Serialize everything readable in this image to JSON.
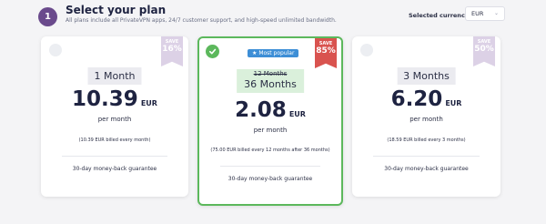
{
  "header": {
    "step_number": "1",
    "title": "Select your plan",
    "subtitle": "All plans include all PrivateVPN apps, 24/7 customer support, and high-speed unlimited bandwidth.",
    "currency_label": "Selected currency:",
    "currency_value": "EUR"
  },
  "plans": [
    {
      "duration": "1 Month",
      "price": "10.39",
      "currency": "EUR",
      "per": "per month",
      "billed": "(10.39 EUR billed every month)",
      "guarantee": "30-day money-back guarantee",
      "badge_top": "SAVE",
      "badge_value": "16%",
      "selected": false
    },
    {
      "badge_popular": "Most popular",
      "original_duration": "12 Months",
      "duration": "36 Months",
      "price": "2.08",
      "currency": "EUR",
      "per": "per month",
      "billed": "(75.00 EUR billed every 12 months after 36 months)",
      "guarantee": "30-day money-back guarantee",
      "badge_top": "SAVE",
      "badge_value": "85%",
      "selected": true
    },
    {
      "duration": "3 Months",
      "price": "6.20",
      "currency": "EUR",
      "per": "per month",
      "billed": "(18.59 EUR billed every 3 months)",
      "guarantee": "30-day money-back guarantee",
      "badge_top": "SAVE",
      "badge_value": "50%",
      "selected": false
    }
  ],
  "colors": {
    "accent_purple": "#6a4a8c",
    "selected_green": "#5cb85c",
    "save_red": "#d9534f",
    "save_lavender": "#dcd1e6",
    "popular_blue": "#3d8ed6"
  },
  "icons": {
    "checkmark": "check-icon",
    "star": "star-icon",
    "dropdown": "chevron-down-icon"
  }
}
